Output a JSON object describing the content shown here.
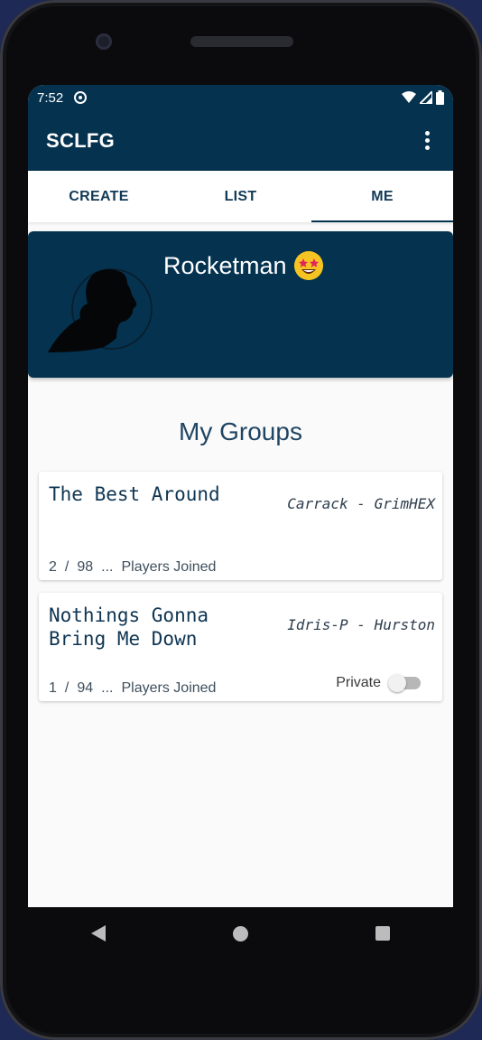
{
  "status_bar": {
    "time": "7:52"
  },
  "app": {
    "title": "SCLFG"
  },
  "tabs": [
    {
      "label": "CREATE"
    },
    {
      "label": "LIST"
    },
    {
      "label": "ME"
    }
  ],
  "active_tab": "ME",
  "profile": {
    "username": "Rocketman"
  },
  "section_title": "My Groups",
  "groups": [
    {
      "name": "The Best Around",
      "ship": "Carrack - GrimHEX",
      "players_current": "2",
      "separator": "/",
      "players_max": "98",
      "ellipsis": "...",
      "players_label": "Players Joined"
    },
    {
      "name": "Nothings Gonna Bring Me Down",
      "ship": "Idris-P - Hurston",
      "players_current": "1",
      "separator": "/",
      "players_max": "94",
      "ellipsis": "...",
      "players_label": "Players Joined",
      "private_label": "Private",
      "private_on": false
    }
  ],
  "colors": {
    "primary": "#04324f",
    "background": "#fafafa",
    "text_dark": "#0f3552"
  },
  "icons": [
    "sync-icon",
    "wifi-icon",
    "signal-icon",
    "battery-icon",
    "more-vert-icon",
    "avatar-silhouette",
    "star-struck-emoji",
    "nav-back-icon",
    "nav-home-icon",
    "nav-recents-icon"
  ]
}
